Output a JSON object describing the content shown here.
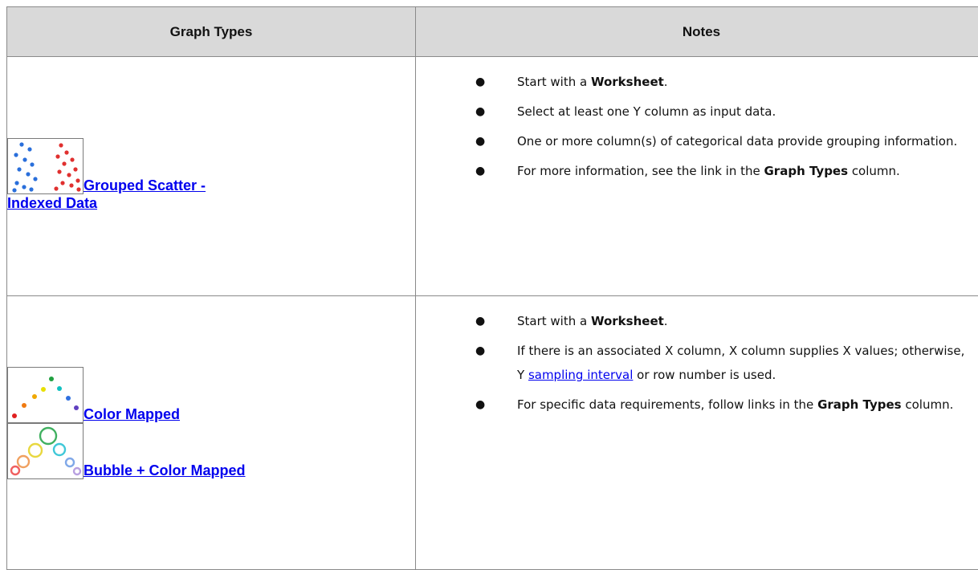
{
  "header": {
    "graph_types": "Graph Types",
    "notes": "Notes"
  },
  "rows": [
    {
      "types": [
        {
          "label": "Grouped Scatter -",
          "label_line2": "Indexed Data",
          "icon": "grouped-scatter-thumbnail"
        }
      ],
      "notes": [
        {
          "pre": "Start with a ",
          "bold": "Worksheet",
          "post": "."
        },
        {
          "text": "Select at least one Y column as input data."
        },
        {
          "text": "One or more column(s) of categorical data provide grouping information."
        },
        {
          "pre": "For more information, see the link in the ",
          "bold": "Graph Types",
          "post": " column."
        }
      ]
    },
    {
      "types": [
        {
          "label": "Color Mapped",
          "icon": "color-mapped-thumbnail"
        },
        {
          "label": "Bubble + Color Mapped",
          "icon": "bubble-color-mapped-thumbnail"
        }
      ],
      "notes": [
        {
          "pre": "Start with a ",
          "bold": "Worksheet",
          "post": "."
        },
        {
          "pre": "If there is an associated X column, X column supplies X values; otherwise, Y ",
          "link": "sampling interval",
          "post": " or row number is used."
        },
        {
          "pre": "For specific data requirements, follow links in the ",
          "bold": "Graph Types",
          "post": " column."
        }
      ]
    }
  ],
  "colors": {
    "link": "#0000ee",
    "header_bg": "#d9d9d9",
    "border": "#8a8a8a"
  }
}
